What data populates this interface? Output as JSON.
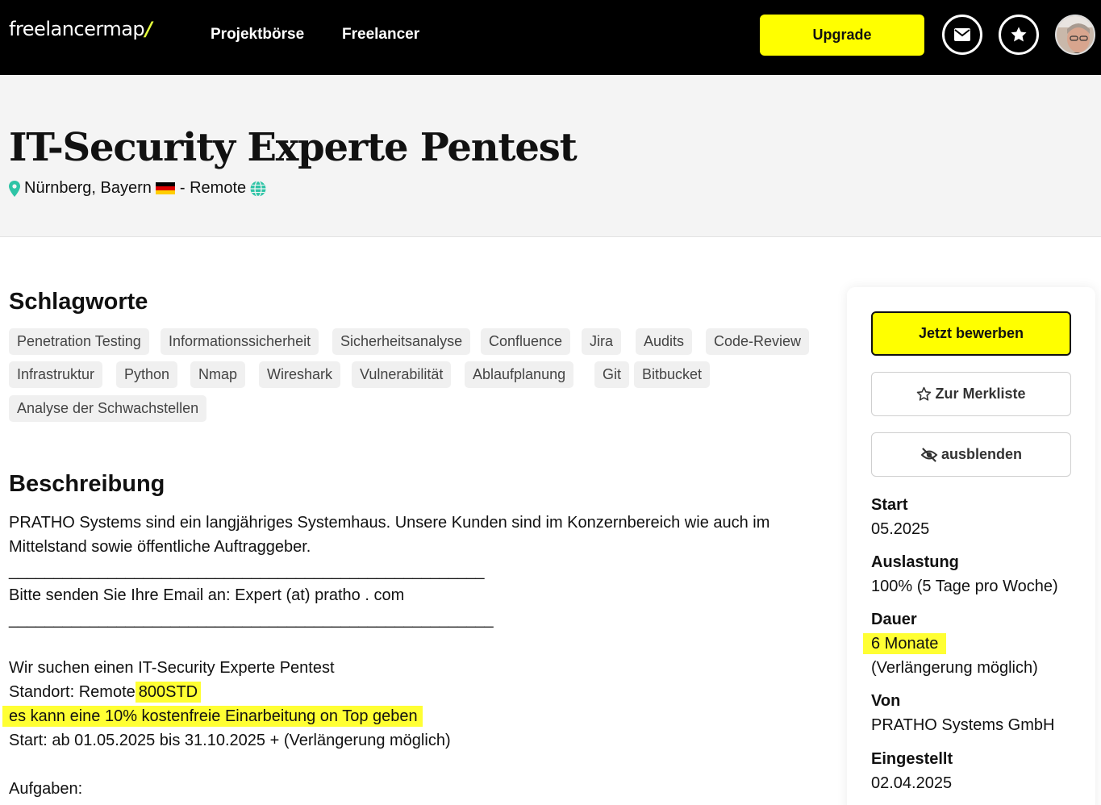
{
  "header": {
    "logo_text": "freelancermap",
    "logo_slash": "/",
    "nav": [
      "Projektbörse",
      "Freelancer"
    ],
    "upgrade_label": "Upgrade",
    "icons": [
      "envelope-icon",
      "star-icon",
      "avatar"
    ]
  },
  "project": {
    "title": "IT-Security Experte Pentest",
    "location": "Nürnberg, Bayern",
    "separator": "- Remote",
    "location_icons": [
      "map-pin-icon",
      "flag-germany-icon",
      "globe-icon"
    ]
  },
  "tags_section": {
    "heading": "Schlagworte",
    "tags": [
      "Penetration Testing",
      "Informationssicherheit",
      "Sicherheitsanalyse",
      "Confluence",
      "Jira",
      "Audits",
      "Code-Review",
      "Infrastruktur",
      "Python",
      "Nmap",
      "Wireshark",
      "Vulnerabilität",
      "Ablaufplanung",
      "Git",
      "Bitbucket",
      "Analyse der Schwachstellen"
    ]
  },
  "description": {
    "heading": "Beschreibung",
    "line1": "PRATHO Systems sind ein langjähriges Systemhaus. Unsere Kunden sind im Konzernbereich wie auch im",
    "line2": "Mittelstand sowie öffentliche Auftraggeber.",
    "divider1": "_____________________________________________________",
    "line3": "Bitte senden Sie Ihre Email an: Expert (at) pratho . com",
    "divider2": "______________________________________________________",
    "line4": "Wir suchen einen IT-Security Experte Pentest",
    "line5_prefix": "Standort: Remote",
    "line5_highlight": "800STD",
    "line6": "es kann eine 10% kostenfreie Einarbeitung on Top geben",
    "line7": "Start: ab 01.05.2025 bis 31.10.2025 + (Verlängerung möglich)",
    "line8": "Aufgaben:"
  },
  "sidebar": {
    "apply_label": "Jetzt bewerben",
    "watchlist_label": "Zur Merkliste",
    "hide_label": "ausblenden",
    "start_label": "Start",
    "start_value": "05.2025",
    "workload_label": "Auslastung",
    "workload_value": "100% (5 Tage pro Woche)",
    "duration_label": "Dauer",
    "duration_value": "6 Monate",
    "duration_note": "(Verlängerung möglich)",
    "from_label": "Von",
    "from_value": "PRATHO Systems GmbH",
    "posted_label": "Eingestellt",
    "posted_value": "02.04.2025"
  },
  "colors": {
    "accent_yellow": "#ffff00",
    "highlight_yellow": "#ffff33",
    "topbar": "#000000",
    "hero_bg": "#f4f4f4",
    "pin_teal": "#2ec4a6"
  }
}
